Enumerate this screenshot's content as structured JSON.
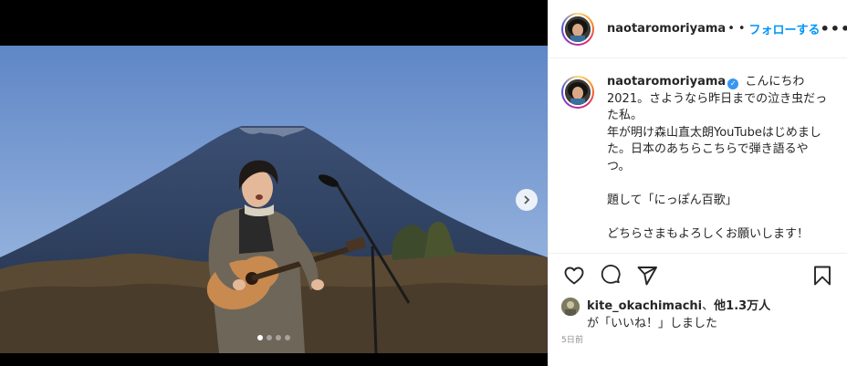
{
  "post": {
    "username": "naotaromoriyama",
    "verified": true,
    "header_truncation": "•",
    "header_separator": "•",
    "follow_label": "フォローする",
    "more_label": "•••",
    "caption": "こんにちわ\n2021。さようなら昨日までの泣き虫だった私。\n年が明け森山直太朗YouTubeはじめました。日本のあちらこちらで弾き語るやつ。\n\n題して「にっぽん百歌」\n\nどちらさまもよろしくお願いします！",
    "liked_by_user": "kite_okachimachi",
    "liked_by_separator": "、",
    "likes_others": "他1.3万人",
    "likes_suffix": "が「いいね！」しました",
    "date": "5日前"
  },
  "media": {
    "carousel_count": 4,
    "carousel_active_index": 0
  },
  "icons": {
    "like": "heart-icon",
    "comment": "comment-icon",
    "share": "paper-plane-icon",
    "save": "bookmark-icon",
    "next": "chevron-right-icon"
  },
  "colors": {
    "follow": "#0095f6",
    "verified": "#3897f0",
    "text": "#262626",
    "muted": "#8e8e8e"
  }
}
